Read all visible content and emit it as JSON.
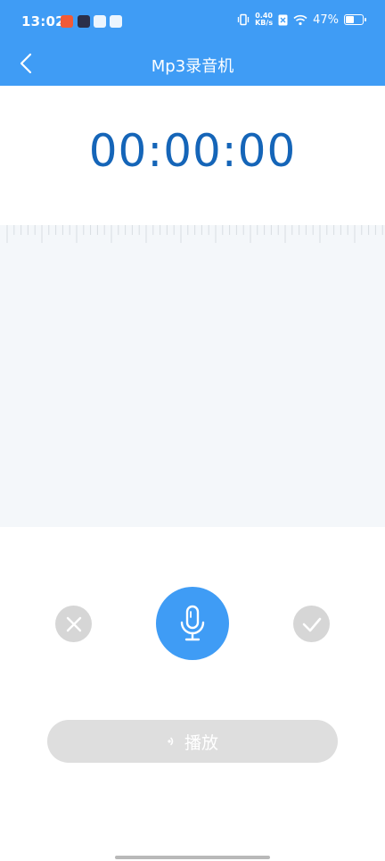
{
  "status_bar": {
    "time": "13:02",
    "net_speed_value": "0.40",
    "net_speed_unit": "KB/s",
    "battery": "47%",
    "battery_level": 0.47
  },
  "header": {
    "title": "Mp3录音机",
    "background": "#3f9cf5"
  },
  "recorder": {
    "timer": "00:00:00",
    "timer_color": "#1565b8"
  },
  "controls": {
    "cancel_icon": "close-icon",
    "record_icon": "microphone-icon",
    "confirm_icon": "check-icon"
  },
  "play_button": {
    "label": "播放",
    "icon": "play-sound-icon"
  }
}
